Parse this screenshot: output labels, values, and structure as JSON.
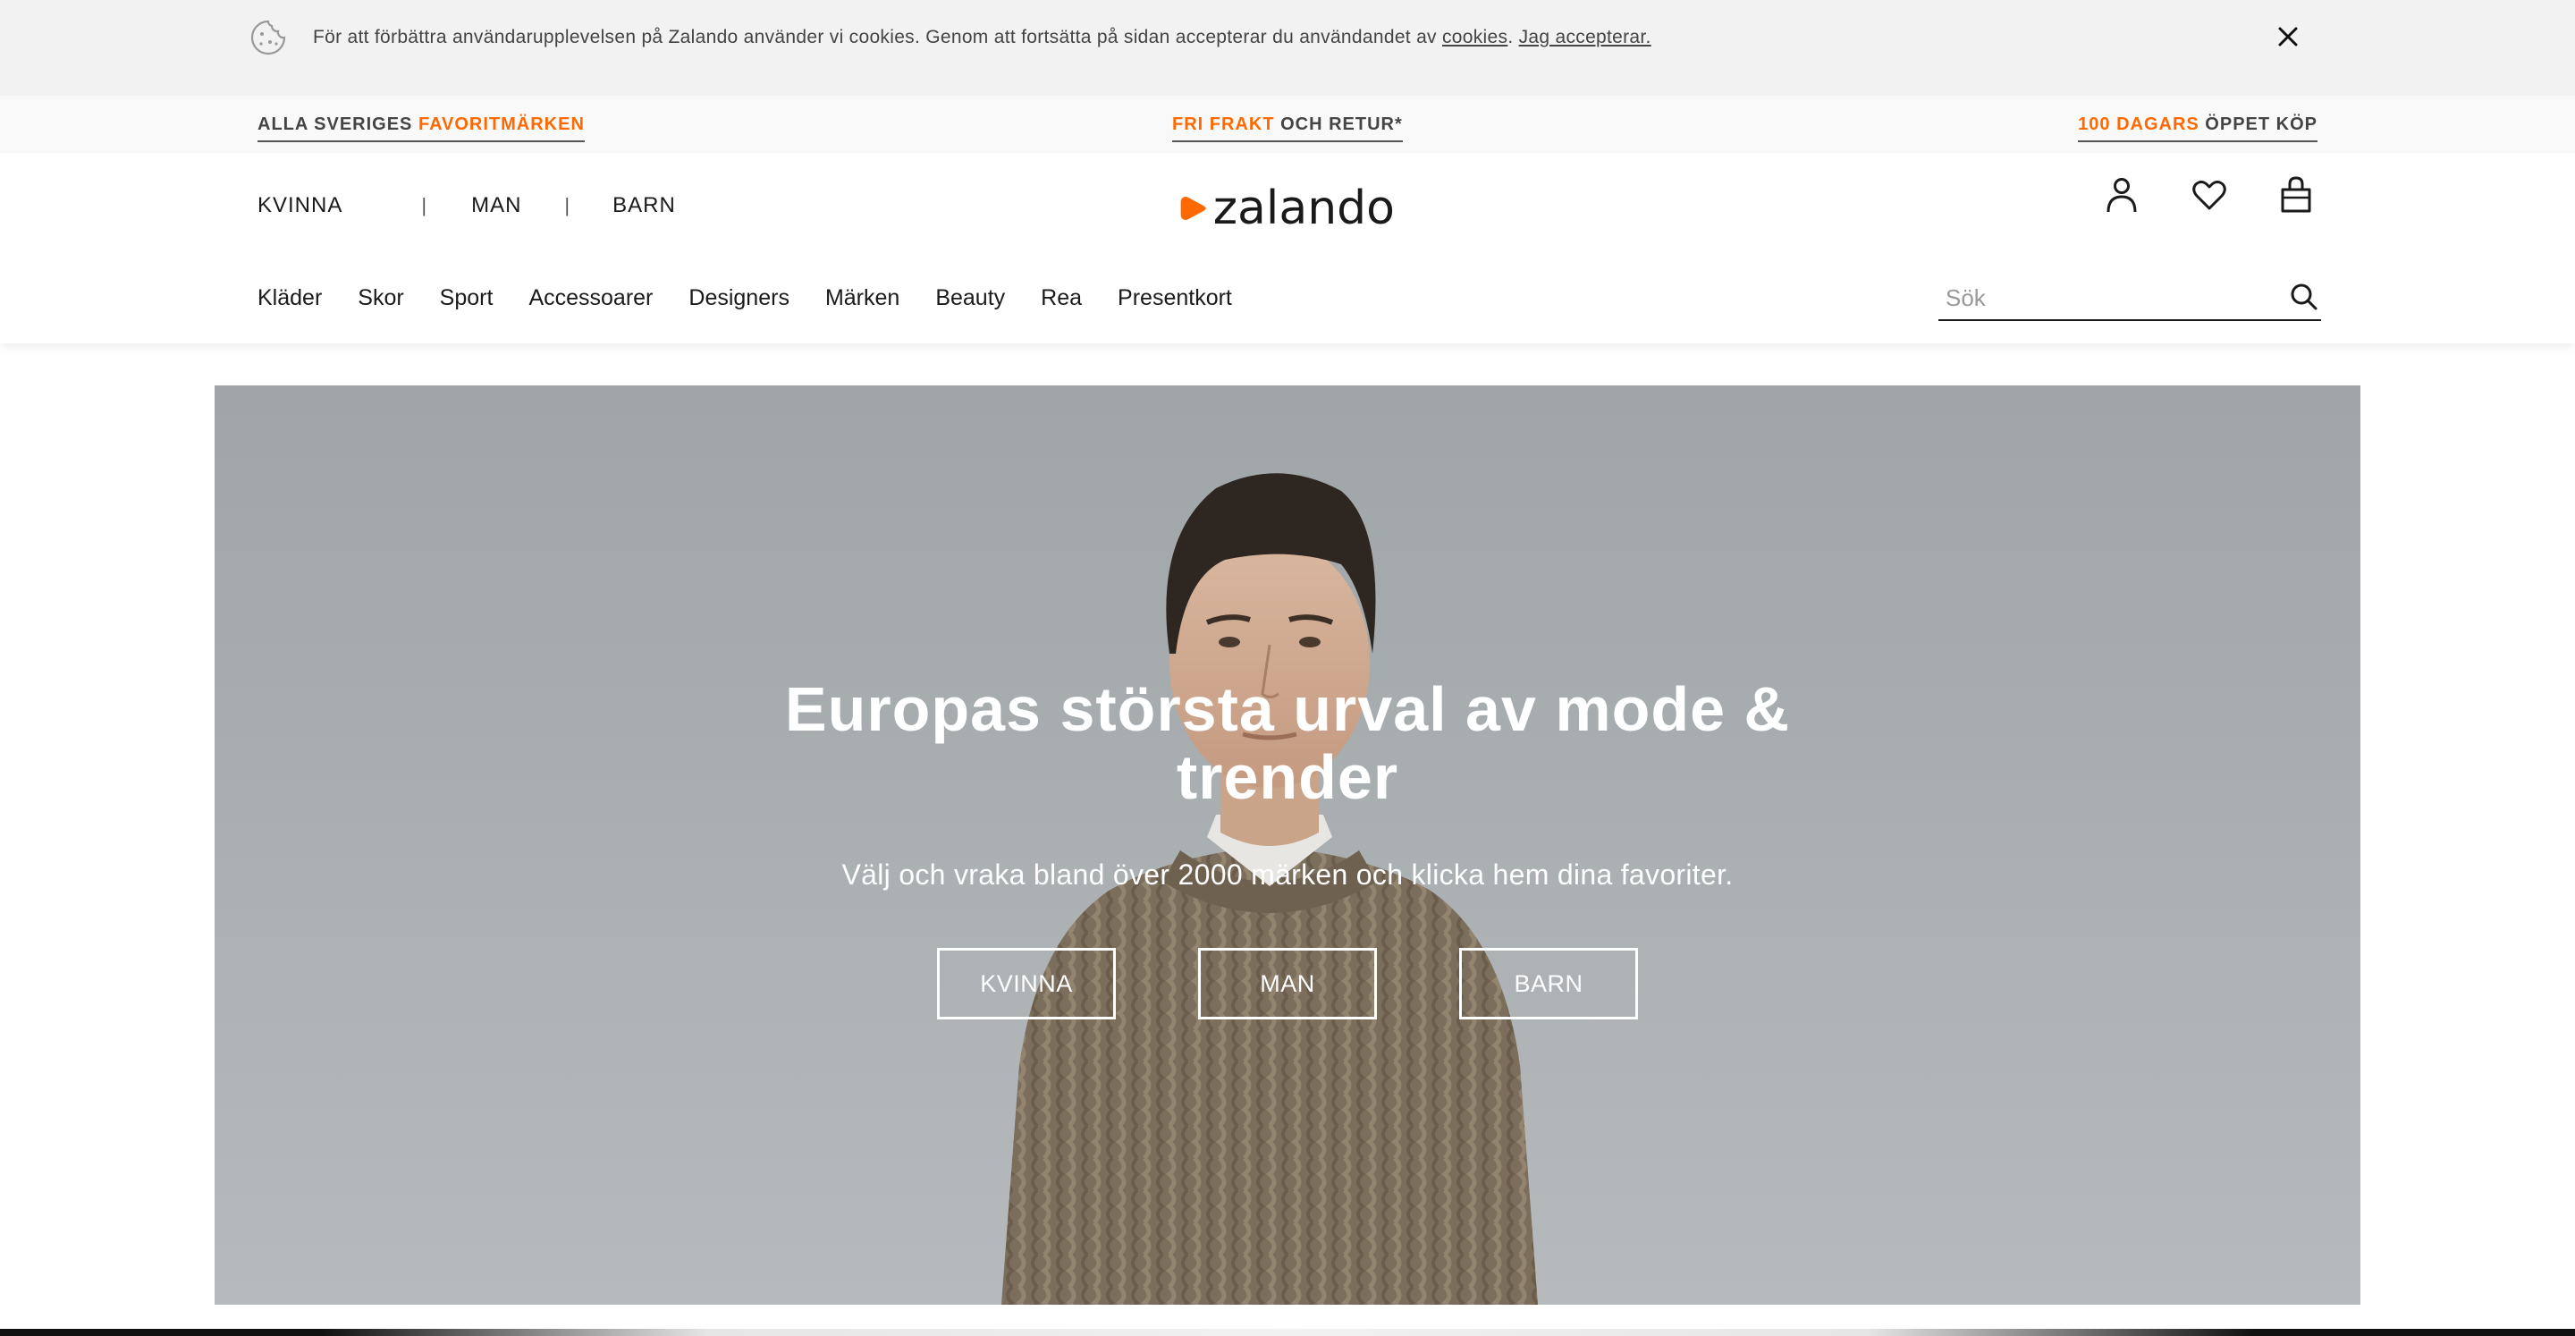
{
  "cookie_banner": {
    "text_before": "För att förbättra användarupplevelsen på Zalando använder vi cookies. Genom att fortsätta på sidan accepterar du användandet av ",
    "cookies_link": "cookies",
    "separator": ".",
    "accept_link": "Jag accepterar."
  },
  "usp": {
    "brands": {
      "prefix": "ALLA SVERIGES ",
      "accent": "FAVORITMÄRKEN"
    },
    "shipping": {
      "accent": "FRI FRAKT",
      "suffix": " OCH RETUR*"
    },
    "returns": {
      "accent": "100 DAGARS",
      "suffix": " ÖPPET KÖP"
    }
  },
  "header": {
    "gender_nav": [
      "KVINNA",
      "MAN",
      "BARN"
    ],
    "separator": "|",
    "logo_text": "zalando",
    "categories": [
      "Kläder",
      "Skor",
      "Sport",
      "Accessoarer",
      "Designers",
      "Märken",
      "Beauty",
      "Rea",
      "Presentkort"
    ],
    "search_placeholder": "Sök"
  },
  "hero": {
    "title_line1": "Europas största urval av mode &",
    "title_line2": "trender",
    "subtitle": "Välj och vraka bland över 2000 märken och klicka hem dina favoriter.",
    "buttons": [
      "KVINNA",
      "MAN",
      "BARN"
    ]
  },
  "colors": {
    "accent": "#ff6900",
    "banner_bg": "#f2f2f2",
    "hero_bg": "#a8adb0"
  },
  "icons": [
    "cookie-icon",
    "close-icon",
    "account-icon",
    "heart-icon",
    "bag-icon",
    "search-icon"
  ]
}
